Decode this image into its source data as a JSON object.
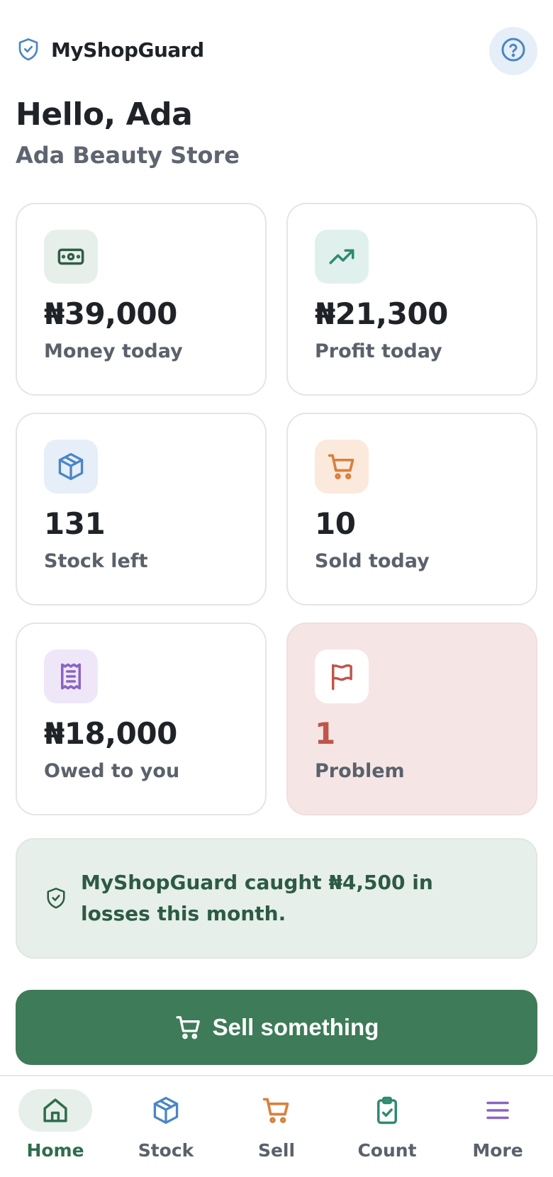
{
  "app": {
    "name": "MyShopGuard"
  },
  "header": {
    "greeting": "Hello, Ada",
    "store_name": "Ada Beauty Store",
    "help_icon": "help-circle-icon"
  },
  "stats": [
    {
      "value": "₦39,000",
      "label": "Money today",
      "icon": "banknote-icon",
      "icon_bg": "#e6efea",
      "icon_color": "#2f5c45"
    },
    {
      "value": "₦21,300",
      "label": "Profit today",
      "icon": "trending-up-icon",
      "icon_bg": "#e0f0ec",
      "icon_color": "#2f8a72"
    },
    {
      "value": "131",
      "label": "Stock left",
      "icon": "box-icon",
      "icon_bg": "#e6eef8",
      "icon_color": "#4a86c5"
    },
    {
      "value": "10",
      "label": "Sold today",
      "icon": "cart-icon",
      "icon_bg": "#fbe9dc",
      "icon_color": "#d9803e"
    },
    {
      "value": "₦18,000",
      "label": "Owed to you",
      "icon": "receipt-icon",
      "icon_bg": "#efe7f8",
      "icon_color": "#8a63c4"
    },
    {
      "value": "1",
      "label": "Problem",
      "icon": "flag-icon",
      "icon_bg": "#ffffff",
      "icon_color": "#c0554a"
    }
  ],
  "notice": {
    "text": "MyShopGuard caught ₦4,500 in losses this month.",
    "icon": "shield-check-icon"
  },
  "cta": {
    "label": "Sell something",
    "icon": "cart-icon"
  },
  "nav": [
    {
      "label": "Home",
      "icon": "home-icon",
      "active": true
    },
    {
      "label": "Stock",
      "icon": "box-icon",
      "active": false
    },
    {
      "label": "Sell",
      "icon": "cart-icon",
      "active": false
    },
    {
      "label": "Count",
      "icon": "clipboard-check-icon",
      "active": false
    },
    {
      "label": "More",
      "icon": "menu-icon",
      "active": false
    }
  ],
  "colors": {
    "primary": "#3e7b58",
    "alert_bg": "#f5e6e5",
    "alert_text": "#c0554a",
    "notice_bg": "#e6efea"
  }
}
